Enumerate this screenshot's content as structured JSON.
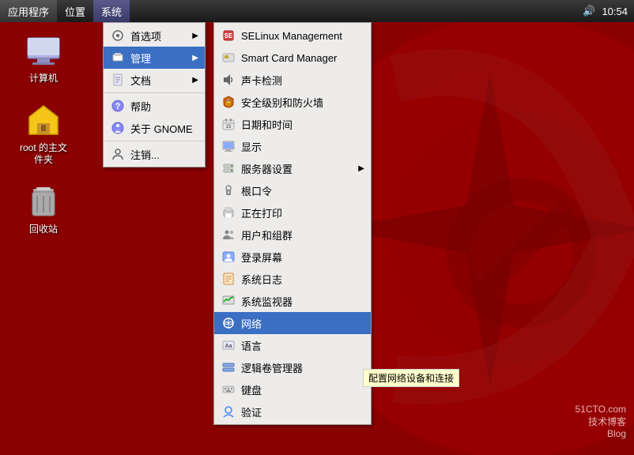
{
  "taskbar": {
    "items": [
      {
        "label": "应用程序",
        "active": false
      },
      {
        "label": "位置",
        "active": false
      },
      {
        "label": "系统",
        "active": true
      }
    ],
    "time": "10:54"
  },
  "desktop_icons": [
    {
      "label": "计算机",
      "icon": "computer"
    },
    {
      "label": "root 的主文件夹",
      "icon": "folder"
    },
    {
      "label": "回收站",
      "icon": "trash"
    }
  ],
  "main_menu": {
    "items": [
      {
        "label": "首选项",
        "icon": "prefs",
        "has_submenu": true
      },
      {
        "label": "管理",
        "icon": "admin",
        "has_submenu": true,
        "active": true
      },
      {
        "label": "文档",
        "icon": "docs",
        "has_submenu": true
      },
      {
        "label": "帮助",
        "icon": "help",
        "has_submenu": false
      },
      {
        "label": "关于 GNOME",
        "icon": "gnome",
        "has_submenu": false
      },
      {
        "label": "注销...",
        "icon": "logout",
        "has_submenu": false
      }
    ]
  },
  "admin_submenu": {
    "items": [
      {
        "label": "SELinux Management",
        "icon": "selinux",
        "active": false
      },
      {
        "label": "Smart Card Manager",
        "icon": "smartcard",
        "active": false
      },
      {
        "label": "声卡检测",
        "icon": "sound",
        "active": false
      },
      {
        "label": "安全级别和防火墙",
        "icon": "firewall",
        "active": false
      },
      {
        "label": "日期和时间",
        "icon": "datetime",
        "active": false
      },
      {
        "label": "显示",
        "icon": "display",
        "active": false
      },
      {
        "label": "服务器设置",
        "icon": "server",
        "has_submenu": true,
        "active": false
      },
      {
        "label": "根口令",
        "icon": "rootpw",
        "active": false
      },
      {
        "label": "正在打印",
        "icon": "printing",
        "active": false
      },
      {
        "label": "用户和组群",
        "icon": "users",
        "active": false
      },
      {
        "label": "登录屏幕",
        "icon": "login",
        "active": false
      },
      {
        "label": "系统日志",
        "icon": "syslog",
        "active": false
      },
      {
        "label": "系统监视器",
        "icon": "monitor",
        "active": false
      },
      {
        "label": "网络",
        "icon": "network",
        "active": true
      },
      {
        "label": "语言",
        "icon": "lang",
        "active": false
      },
      {
        "label": "逻辑卷管理器",
        "icon": "lvm",
        "active": false
      },
      {
        "label": "键盘",
        "icon": "keyboard",
        "active": false
      },
      {
        "label": "验证",
        "icon": "auth",
        "active": false
      }
    ]
  },
  "tooltip": {
    "text": "配置网络设备和连接"
  },
  "watermark": {
    "line1": "51CTO.com",
    "line2": "技术博客",
    "line3": "Blog"
  }
}
